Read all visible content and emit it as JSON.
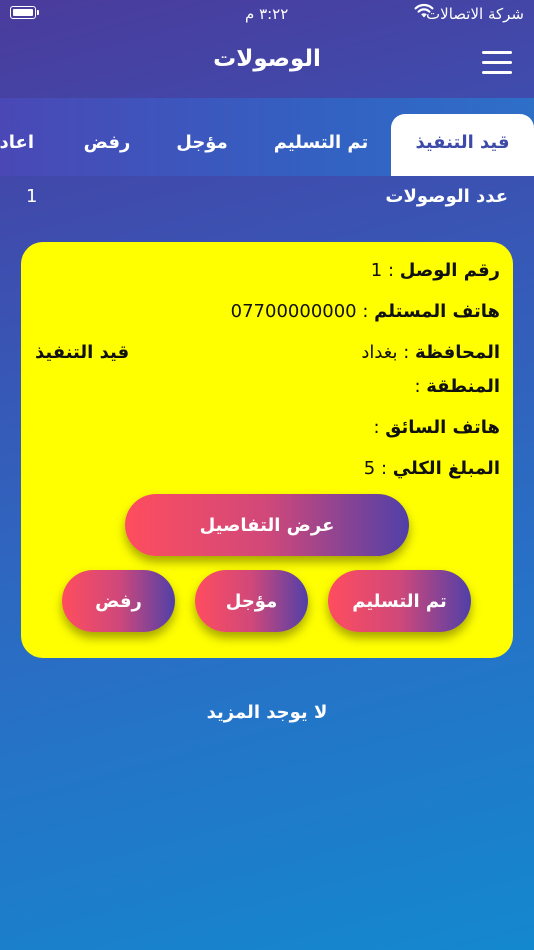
{
  "status_bar": {
    "carrier": "شركة الاتصالات",
    "time": "٣:٢٢ م"
  },
  "header": {
    "title": "الوصولات"
  },
  "tabs": [
    {
      "label": "قيد التنفيذ",
      "active": true
    },
    {
      "label": "تم التسليم",
      "active": false
    },
    {
      "label": "مؤجل",
      "active": false
    },
    {
      "label": "رفض",
      "active": false
    },
    {
      "label": "اعادة",
      "active": false
    }
  ],
  "summary": {
    "count_label": "عدد الوصولات",
    "count_value": "1"
  },
  "card": {
    "receipt_label": "رقم الوصل",
    "receipt_value": "1",
    "phone_label": "هاتف المستلم",
    "phone_value": "07700000000",
    "province_label": "المحافظة",
    "province_value": "بغداد",
    "area_label": "المنطقة",
    "area_value": "",
    "driver_label": "هاتف السائق",
    "driver_value": "",
    "total_label": "المبلغ الكلي",
    "total_value": "5",
    "status": "قيد التنفيذ",
    "details_button": "عرض التفاصيل",
    "delivered_button": "تم التسليم",
    "postponed_button": "مؤجل",
    "reject_button": "رفض"
  },
  "footer": {
    "no_more": "لا يوجد المزيد"
  }
}
